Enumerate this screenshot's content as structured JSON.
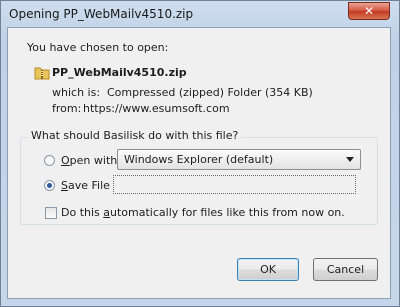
{
  "window": {
    "title": "Opening PP_WebMailv4510.zip",
    "close_glyph": "✕"
  },
  "dialog": {
    "prompt": "You have chosen to open:",
    "file_name": "PP_WebMailv4510.zip",
    "file_icon": "zip-folder-icon",
    "which_is_label": "which is:",
    "which_is_value": "Compressed (zipped) Folder (354 KB)",
    "from_label": "from:",
    "from_value": "https://www.esumsoft.com",
    "question": "What should Basilisk do with this file?",
    "open_with": {
      "label_mnemonic": "O",
      "label_rest": "pen with",
      "selected": false,
      "app_value": "Windows Explorer (default)"
    },
    "save_file": {
      "label_mnemonic": "S",
      "label_rest": "ave File",
      "selected": true
    },
    "auto_checkbox": {
      "label_prefix": "Do this ",
      "label_mnemonic": "a",
      "label_rest": "utomatically for files like this from now on.",
      "checked": false
    },
    "ok_label": "OK",
    "cancel_label": "Cancel"
  },
  "colors": {
    "accent": "#2c5aa0",
    "folder": "#e8c45a",
    "close_red": "#c23a22"
  }
}
